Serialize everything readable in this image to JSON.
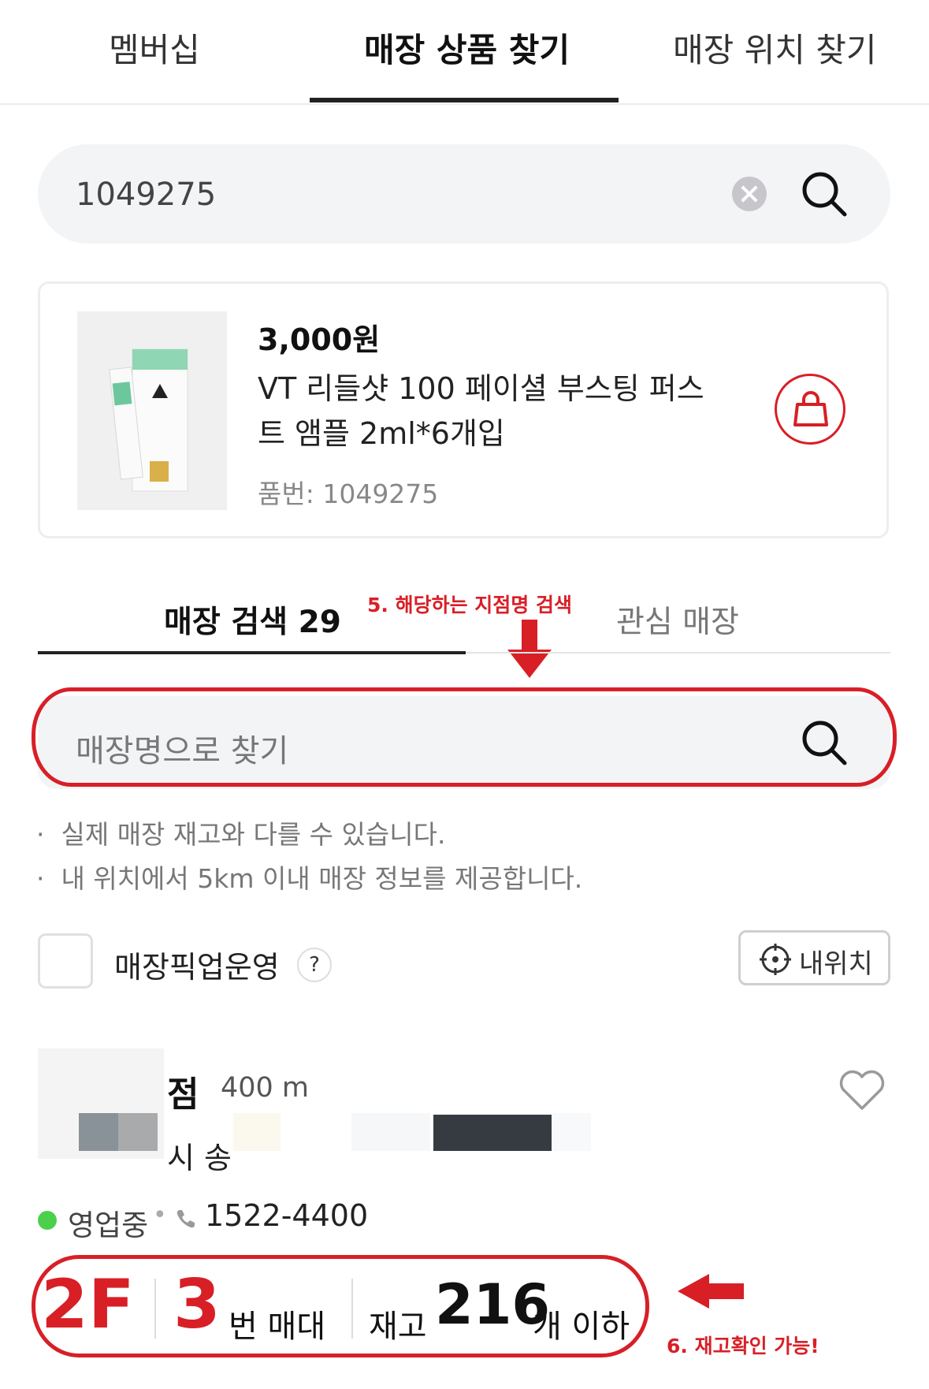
{
  "top_tabs": [
    "멤버십",
    "매장 상품 찾기",
    "매장 위치 찾기"
  ],
  "search": {
    "value": "1049275"
  },
  "product": {
    "price": "3,000원",
    "name": "VT 리들샷 100 페이셜 부스팅 퍼스트 앰플 2ml*6개입",
    "sku": "품번: 1049275"
  },
  "store_tabs": {
    "search": "매장 검색 29",
    "favorites": "관심 매장"
  },
  "annotations": {
    "step5": "5. 해당하는 지점명 검색",
    "step6": "6. 재고확인 가능!"
  },
  "store_search": {
    "placeholder": "매장명으로 찾기"
  },
  "notices": [
    "실제 매장 재고와 다를 수 있습니다.",
    "내 위치에서 5km 이내 매장 정보를 제공합니다."
  ],
  "pickup_filter": {
    "label": "매장픽업운영",
    "help": "?"
  },
  "my_location_button": "내위치",
  "store": {
    "name_fragment": "점",
    "distance": "400 m",
    "address_fragment": "시 송",
    "status": "영업중",
    "phone": "1522-4400",
    "floor": "2F",
    "shelf_number": "3",
    "shelf_label": "번 매대",
    "stock_prefix": "재고",
    "stock_count": "216",
    "stock_suffix": "개 이하"
  },
  "colors": {
    "accent": "#d81f26",
    "open": "#4cd04c"
  }
}
